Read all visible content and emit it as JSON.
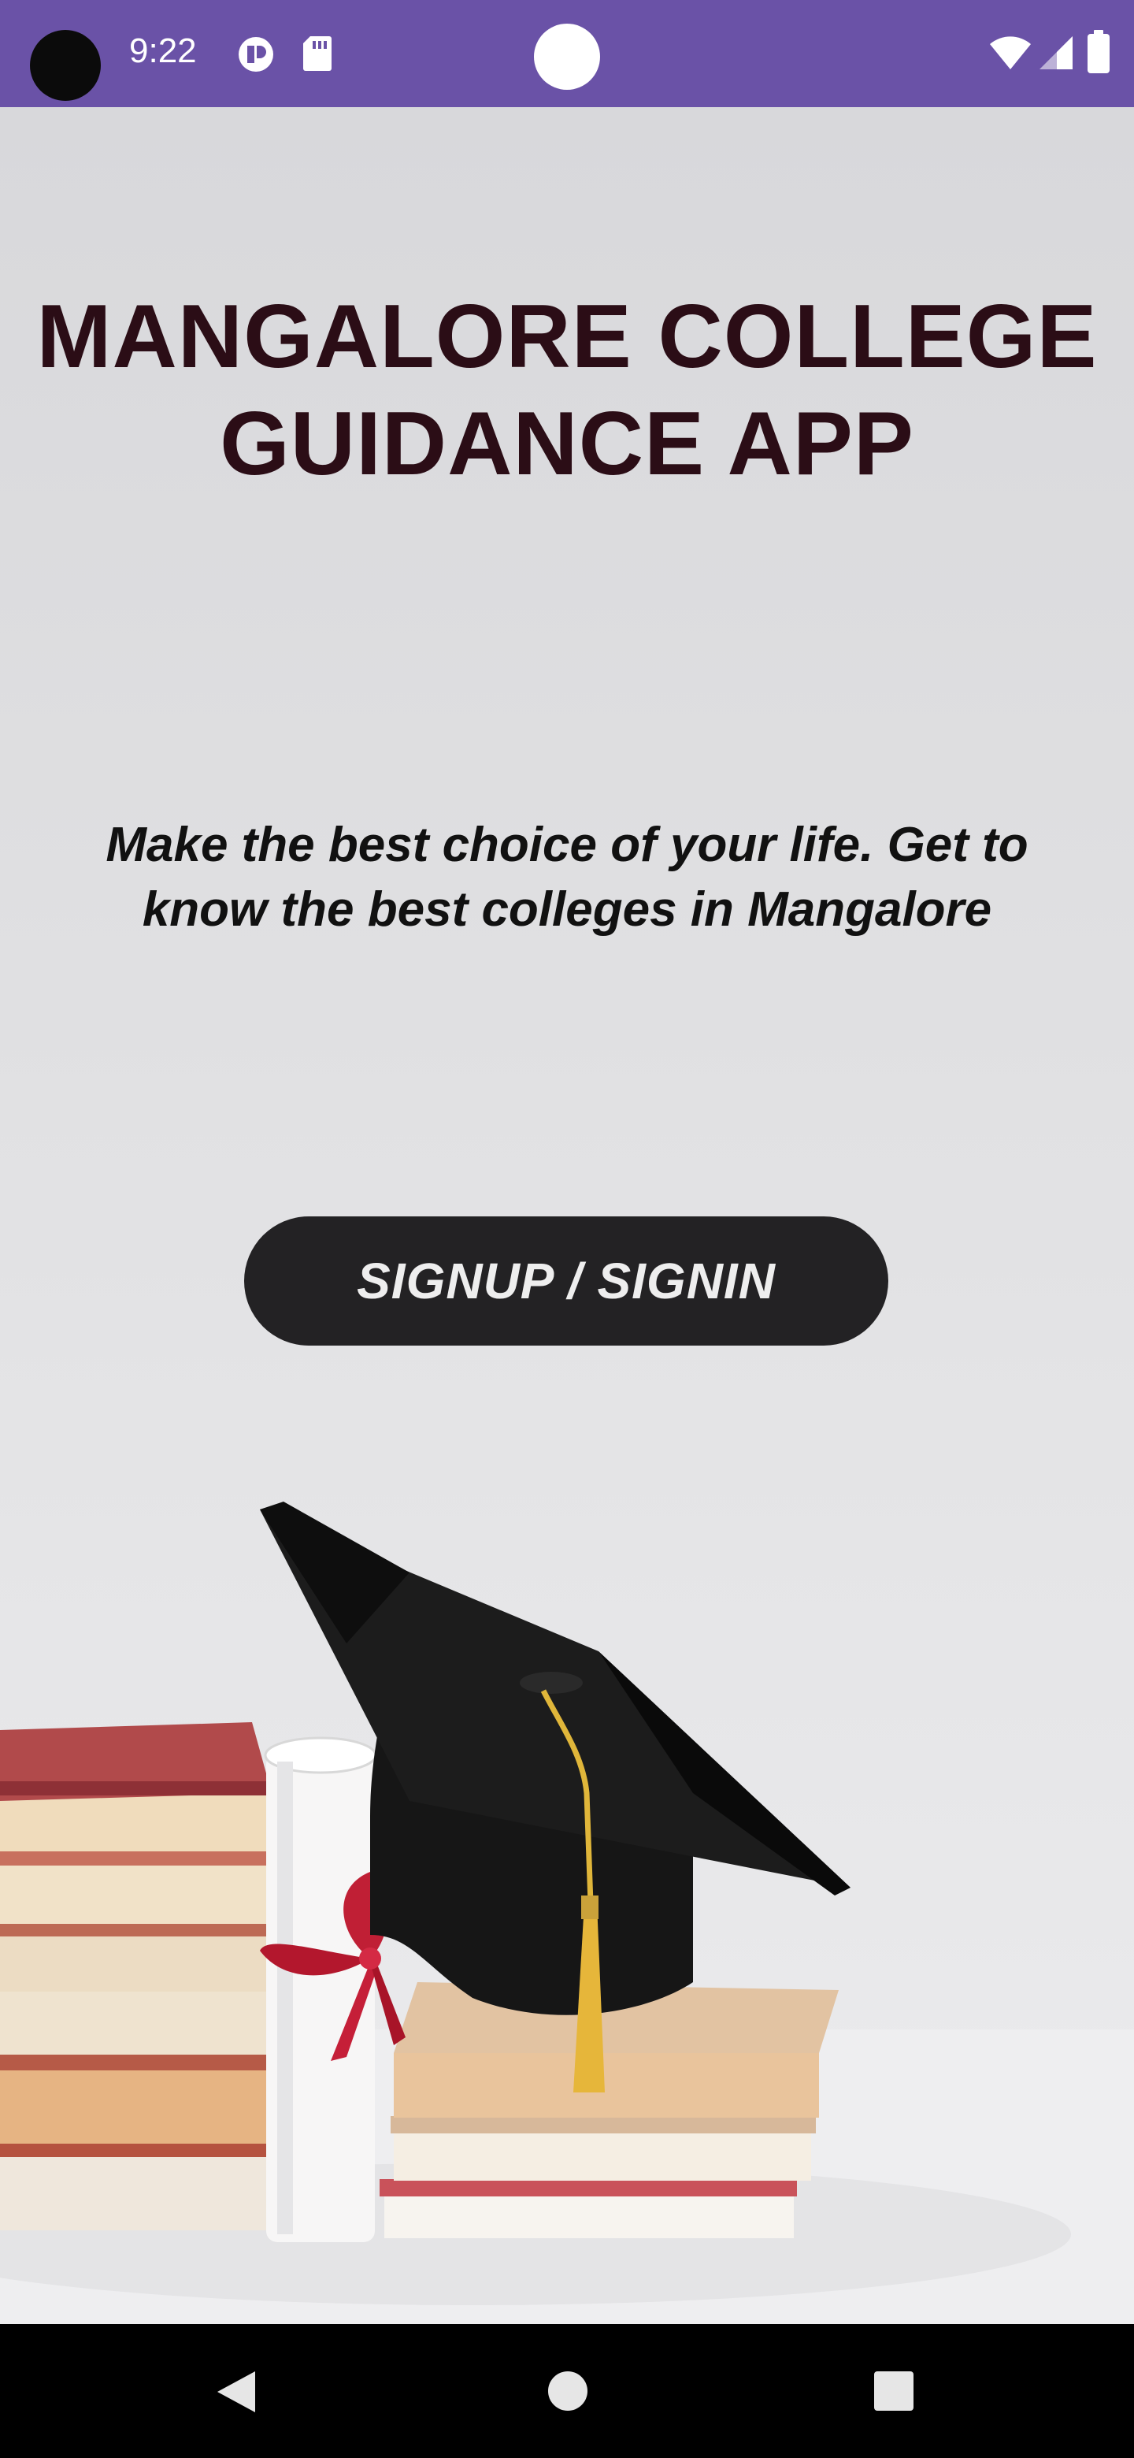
{
  "status_bar": {
    "time": "9:22",
    "icons": [
      "camera-cutout",
      "notification-app-icon",
      "sd-card-icon",
      "center-dot",
      "wifi-icon",
      "signal-icon",
      "battery-icon"
    ],
    "background": "#6a52a7"
  },
  "main": {
    "title_line1": "MANGALORE COLLEGE",
    "title_line2": "GUIDANCE APP",
    "tagline": "Make the best choice of your life. Get to know the best colleges in Mangalore",
    "cta_label": "SIGNUP / SIGNIN",
    "title_color": "#2b0d16",
    "button_color": "#232224"
  },
  "scene": {
    "elements": [
      "graduation-cap",
      "tassel",
      "diploma-scroll",
      "red-ribbon",
      "book-stack-left",
      "book-stack-right"
    ]
  },
  "nav_bar": {
    "buttons": [
      "back-icon",
      "home-icon",
      "recents-icon"
    ]
  }
}
